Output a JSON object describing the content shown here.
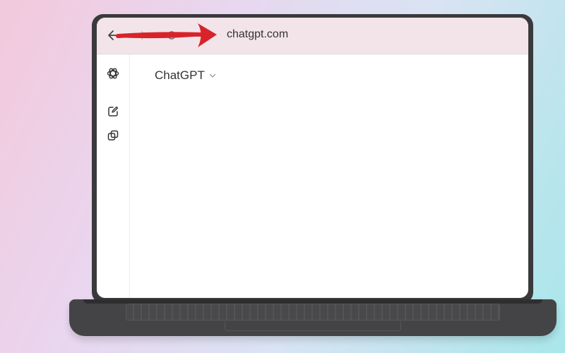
{
  "browser": {
    "url": "chatgpt.com",
    "nav": [
      "back-arrow-icon",
      "forward-arrow-icon",
      "reload-icon"
    ]
  },
  "sidebar": {
    "icons": [
      "openai-logo-icon",
      "new-chat-icon",
      "gpts-icon"
    ]
  },
  "main": {
    "model_label": "ChatGPT"
  },
  "colors": {
    "annotation_arrow": "#d8232a",
    "browser_bar": "#f3e4ea",
    "laptop": "#3a3a3c"
  }
}
